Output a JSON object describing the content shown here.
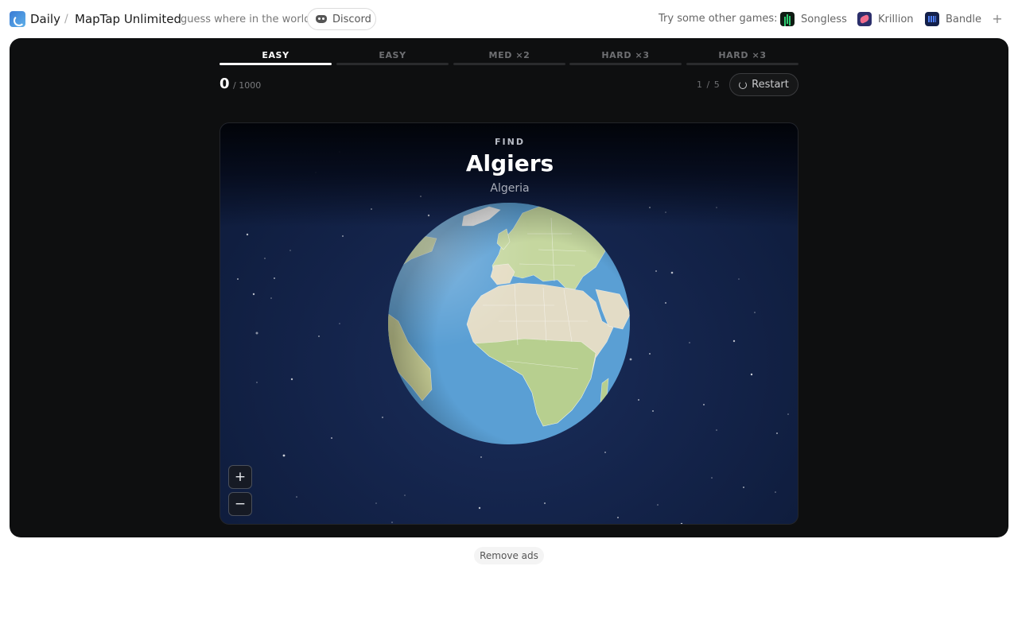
{
  "header": {
    "brand_label": "Daily",
    "separator": "/",
    "title": "MapTap Unlimited",
    "tagline": "guess where in the world",
    "discord_label": "Discord",
    "other_games_label": "Try some other games:",
    "other_games": [
      {
        "label": "Songless",
        "icon": "songless-icon"
      },
      {
        "label": "Krillion",
        "icon": "krillion-icon"
      },
      {
        "label": "Bandle",
        "icon": "bandle-icon"
      }
    ],
    "more_label": "+"
  },
  "game": {
    "tabs": [
      {
        "label": "EASY",
        "active": true
      },
      {
        "label": "EASY",
        "active": false
      },
      {
        "label": "MED ×2",
        "active": false
      },
      {
        "label": "HARD ×3",
        "active": false
      },
      {
        "label": "HARD ×3",
        "active": false
      }
    ],
    "score": "0",
    "score_max": "/ 1000",
    "round": "1 / 5",
    "restart_label": "Restart",
    "find_label": "FIND",
    "target_city": "Algiers",
    "target_country": "Algeria",
    "zoom_in_label": "+",
    "zoom_out_label": "−"
  },
  "footer": {
    "remove_ads_label": "Remove ads"
  },
  "colors": {
    "frame_bg": "#0e0f10",
    "ocean": "#5a9fd4",
    "land": "#e3dcc6",
    "vegetation": "#b7cf8f",
    "space": "#14244b"
  }
}
